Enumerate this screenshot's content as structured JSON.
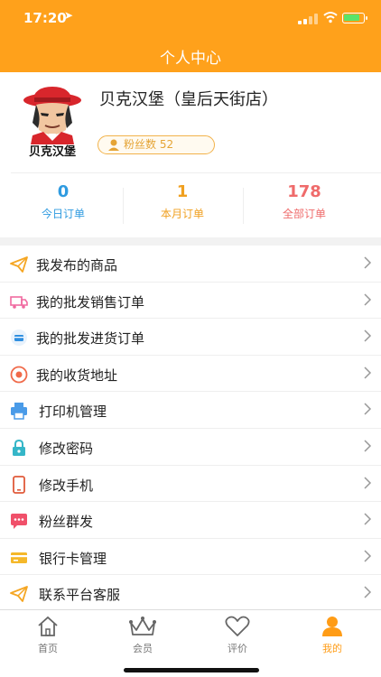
{
  "status_bar": {
    "time": "17:20",
    "location_icon": "location-arrow-icon"
  },
  "header": {
    "title": "个人中心"
  },
  "profile": {
    "logo_text": "贝克汉堡",
    "shop_name": "贝克汉堡（皇后天街店）",
    "fans_label": "粉丝数 52"
  },
  "stats": [
    {
      "value": "0",
      "label": "今日订单",
      "color": "#2f9be0"
    },
    {
      "value": "1",
      "label": "本月订单",
      "color": "#f0a020"
    },
    {
      "value": "178",
      "label": "全部订单",
      "color": "#ef6b6b"
    }
  ],
  "menu": [
    {
      "label": "我发布的商品",
      "icon": "send-plane-icon"
    },
    {
      "label": "我的批发销售订单",
      "icon": "truck-icon"
    },
    {
      "label": "我的批发进货订单",
      "icon": "card-icon"
    },
    {
      "label": "我的收货地址",
      "icon": "location-pin-icon"
    },
    {
      "label": "打印机管理",
      "icon": "printer-icon"
    },
    {
      "label": "修改密码",
      "icon": "lock-icon"
    },
    {
      "label": "修改手机",
      "icon": "phone-icon"
    },
    {
      "label": "粉丝群发",
      "icon": "message-icon"
    },
    {
      "label": "银行卡管理",
      "icon": "bank-card-icon"
    },
    {
      "label": "联系平台客服",
      "icon": "send-plane-icon"
    }
  ],
  "tabs": [
    {
      "label": "首页",
      "icon": "home-icon",
      "active": false
    },
    {
      "label": "会员",
      "icon": "crown-icon",
      "active": false
    },
    {
      "label": "评价",
      "icon": "heart-icon",
      "active": false
    },
    {
      "label": "我的",
      "icon": "user-icon",
      "active": true
    }
  ],
  "colors": {
    "accent": "#ffa11b",
    "active_tab": "#ff9c16"
  }
}
